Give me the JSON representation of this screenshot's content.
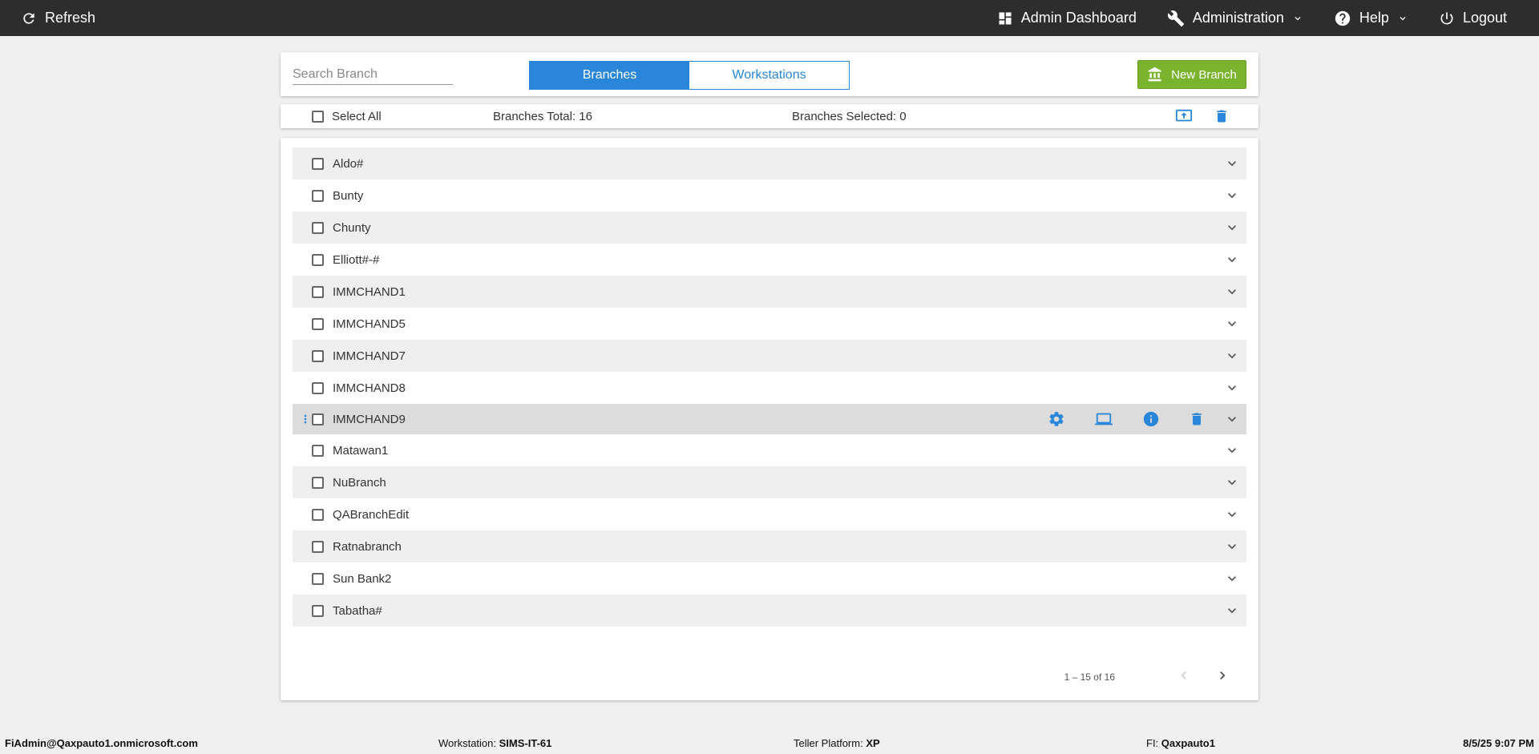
{
  "topbar": {
    "refresh_label": "Refresh",
    "admin_dashboard_label": "Admin Dashboard",
    "administration_label": "Administration",
    "help_label": "Help",
    "logout_label": "Logout"
  },
  "header": {
    "search_placeholder": "Search Branch",
    "tabs": [
      {
        "label": "Branches",
        "active": true
      },
      {
        "label": "Workstations",
        "active": false
      }
    ],
    "new_branch_label": "New Branch"
  },
  "selection": {
    "select_all_label": "Select All",
    "total_text": "Branches Total: 16",
    "selected_text": "Branches Selected: 0"
  },
  "branches": [
    "Aldo#",
    "Bunty",
    "Chunty",
    "Elliott#-#",
    "IMMCHAND1",
    "IMMCHAND5",
    "IMMCHAND7",
    "IMMCHAND8",
    "IMMCHAND9",
    "Matawan1",
    "NuBranch",
    "QABranchEdit",
    "Ratnabranch",
    "Sun Bank2",
    "Tabatha#"
  ],
  "hovered_branch": "IMMCHAND9",
  "pagination": {
    "range_text": "1 – 15 of 16"
  },
  "footer": {
    "user": "FiAdmin@Qaxpauto1.onmicrosoft.com",
    "workstation_label": "Workstation:",
    "workstation_value": "SIMS-IT-61",
    "platform_label": "Teller Platform:",
    "platform_value": "XP",
    "fi_label": "FI:",
    "fi_value": "Qaxpauto1",
    "datetime": "8/5/25 9:07 PM"
  },
  "colors": {
    "accent": "#2a86d8",
    "topbar": "#2d2d2d",
    "new_button": "#7ab32e"
  }
}
